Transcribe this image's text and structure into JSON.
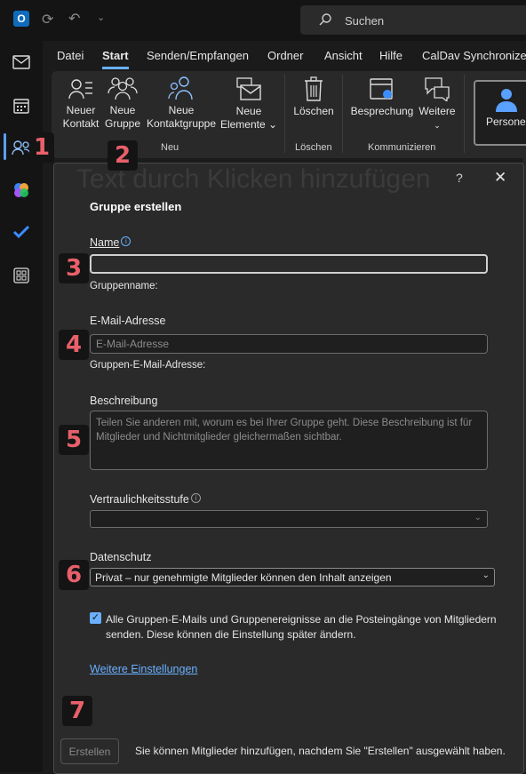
{
  "search": {
    "placeholder": "Suchen"
  },
  "menu": {
    "tabs": [
      "Datei",
      "Start",
      "Senden/Empfangen",
      "Ordner",
      "Ansicht",
      "Hilfe",
      "CalDav Synchronizer"
    ],
    "active": "Start"
  },
  "ribbon": {
    "buttons": {
      "new_contact": [
        "Neuer",
        "Kontakt"
      ],
      "new_group": [
        "Neue",
        "Gruppe"
      ],
      "new_contact_group": [
        "Neue",
        "Kontaktgruppe"
      ],
      "new_items": [
        "Neue",
        "Elemente ⌄"
      ],
      "delete": "Löschen",
      "meeting": "Besprechung",
      "more": "Weitere",
      "people": "Personen"
    },
    "groups": {
      "neu": "Neu",
      "loeschen": "Löschen",
      "kommunizieren": "Kommunizieren"
    }
  },
  "background_text": "Text durch Klicken hinzufügen",
  "dialog": {
    "title": "Gruppe erstellen",
    "help": "?",
    "close": "✕",
    "name": {
      "label": "Name",
      "sublabel": "Gruppenname:",
      "value": ""
    },
    "email": {
      "label": "E-Mail-Adresse",
      "placeholder": "E-Mail-Adresse",
      "sublabel": "Gruppen-E-Mail-Adresse:"
    },
    "description": {
      "label": "Beschreibung",
      "placeholder": "Teilen Sie anderen mit, worum es bei Ihrer Gruppe geht. Diese Beschreibung ist für Mitglieder und Nichtmitglieder gleichermaßen sichtbar."
    },
    "confidentiality": {
      "label": "Vertraulichkeitsstufe",
      "value": ""
    },
    "privacy": {
      "label": "Datenschutz",
      "value": "Privat – nur genehmigte Mitglieder können den Inhalt anzeigen"
    },
    "checkbox": {
      "checked": true,
      "text": "Alle Gruppen-E-Mails und Gruppenereignisse an die Posteingänge von Mitgliedern senden. Diese können die Einstellung später ändern."
    },
    "more_settings": "Weitere Einstellungen",
    "create_button": "Erstellen",
    "footnote": "Sie können Mitglieder hinzufügen, nachdem Sie \"Erstellen\" ausgewählt haben."
  },
  "badges": [
    "1",
    "2",
    "3",
    "4",
    "5",
    "6",
    "7"
  ],
  "colors": {
    "accent": "#6ab0ff",
    "badge_text": "#e8606a",
    "dialog_bg": "#2a2a2a"
  }
}
